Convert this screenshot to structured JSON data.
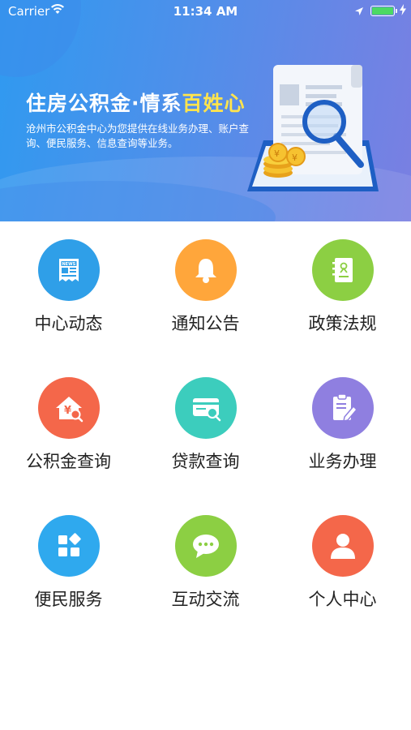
{
  "status_bar": {
    "carrier": "Carrier",
    "time": "11:34 AM"
  },
  "banner": {
    "title_main": "住房公积金·情系",
    "title_highlight": "百姓心",
    "description": "沧州市公积金中心为您提供在线业务办理、账户查询、便民服务、信息查询等业务。"
  },
  "menu": {
    "items": [
      {
        "label": "中心动态",
        "icon": "news-icon",
        "color": "#2f9fe8"
      },
      {
        "label": "通知公告",
        "icon": "bell-icon",
        "color": "#ffa63b"
      },
      {
        "label": "政策法规",
        "icon": "policy-book-icon",
        "color": "#8ccf43"
      },
      {
        "label": "公积金查询",
        "icon": "house-yuan-search-icon",
        "color": "#f4674a"
      },
      {
        "label": "贷款查询",
        "icon": "card-search-icon",
        "color": "#3ccdbd"
      },
      {
        "label": "业务办理",
        "icon": "clipboard-edit-icon",
        "color": "#8f7fe0"
      },
      {
        "label": "便民服务",
        "icon": "apps-grid-icon",
        "color": "#2fa9ee"
      },
      {
        "label": "互动交流",
        "icon": "chat-bubble-icon",
        "color": "#8ccf43"
      },
      {
        "label": "个人中心",
        "icon": "person-icon",
        "color": "#f4674a"
      }
    ]
  }
}
